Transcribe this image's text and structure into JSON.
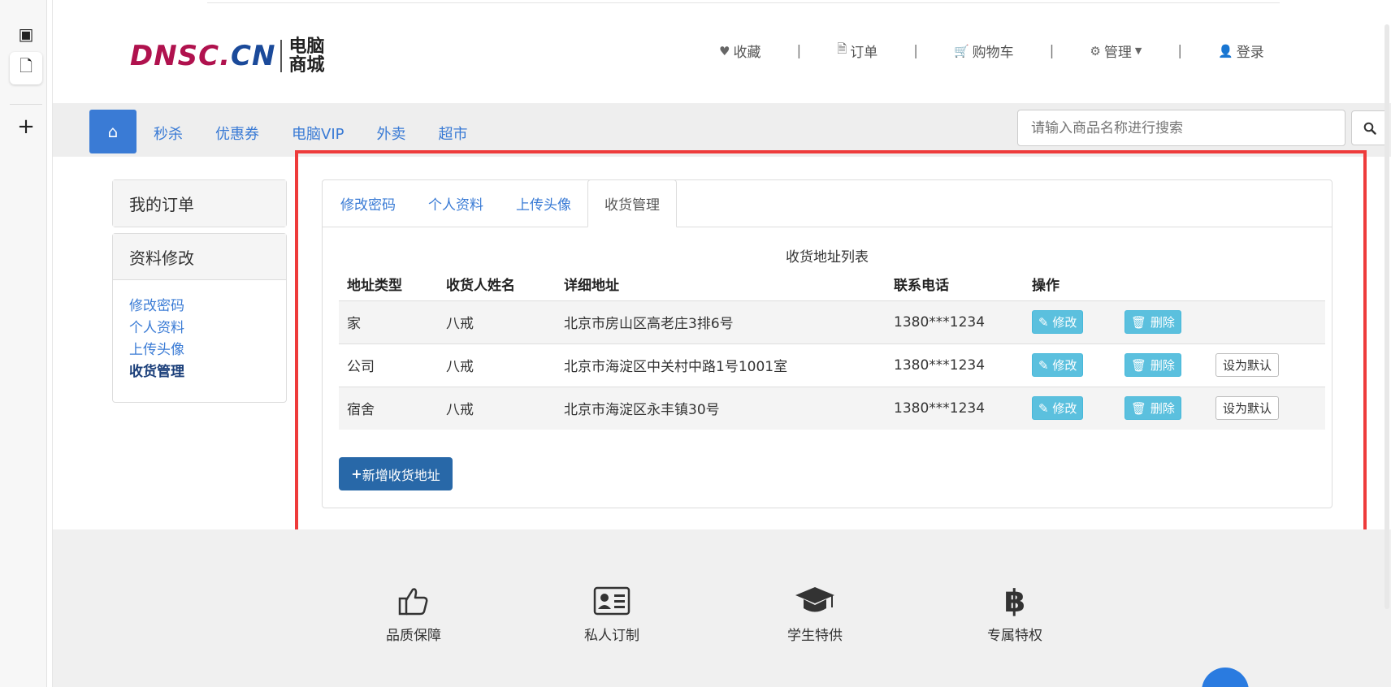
{
  "header": {
    "logo_latin_a": "DNSC.",
    "logo_latin_b": "CN",
    "logo_cn_1": "电脑",
    "logo_cn_2": "商城",
    "links": [
      "收藏",
      "订单",
      "购物车",
      "管理",
      "登录"
    ]
  },
  "nav": {
    "links": [
      "秒杀",
      "优惠券",
      "电脑VIP",
      "外卖",
      "超市"
    ],
    "search_placeholder": "请输入商品名称进行搜索"
  },
  "sidebar": {
    "orders_title": "我的订单",
    "profile_title": "资料修改",
    "profile_links": [
      "修改密码",
      "个人资料",
      "上传头像",
      "收货管理"
    ]
  },
  "main": {
    "tabs": [
      "修改密码",
      "个人资料",
      "上传头像",
      "收货管理"
    ],
    "caption": "收货地址列表",
    "columns": [
      "地址类型",
      "收货人姓名",
      "详细地址",
      "联系电话",
      "操作"
    ],
    "rows": [
      {
        "type": "家",
        "name": "八戒",
        "address": "北京市房山区高老庄3排6号",
        "phone": "1380***1234"
      },
      {
        "type": "公司",
        "name": "八戒",
        "address": "北京市海淀区中关村中路1号1001室",
        "phone": "1380***1234"
      },
      {
        "type": "宿舍",
        "name": "八戒",
        "address": "北京市海淀区永丰镇30号",
        "phone": "1380***1234"
      }
    ],
    "edit_label": "修改",
    "delete_label": "删除",
    "default_label": "设为默认",
    "add_label": "新增收货地址"
  },
  "footer": {
    "features": [
      "品质保障",
      "私人订制",
      "学生特供",
      "专属特权"
    ]
  },
  "colors": {
    "primary": "#3a7bd5",
    "info": "#5bc0de",
    "highlight": "#ee3b3b",
    "logo_red": "#b0124e"
  }
}
